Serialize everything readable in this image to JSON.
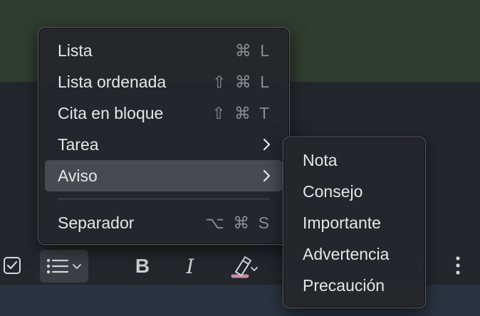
{
  "format_menu": {
    "items": [
      {
        "label": "Lista",
        "shortcut": "⌘ L"
      },
      {
        "label": "Lista ordenada",
        "shortcut": "⇧ ⌘ L"
      },
      {
        "label": "Cita en bloque",
        "shortcut": "⇧ ⌘ T"
      },
      {
        "label": "Tarea",
        "submenu_icon": "chevron-right-icon"
      },
      {
        "label": "Aviso",
        "submenu_icon": "chevron-right-icon",
        "highlighted": true
      },
      {
        "label": "Separador",
        "shortcut": "⌥ ⌘ S"
      }
    ]
  },
  "aviso_submenu": {
    "items": [
      "Nota",
      "Consejo",
      "Importante",
      "Advertencia",
      "Precaución"
    ]
  },
  "toolbar": {
    "bold_label": "B",
    "italic_label": "I",
    "icons": [
      "checkbox-icon",
      "bulleted-list-icon",
      "chevron-down-icon",
      "highlighter-icon",
      "more-vertical-icon"
    ]
  },
  "colors": {
    "menu_bg": "#26272b",
    "highlight": "#484a50",
    "text": "#e6e6e6",
    "shortcut_text": "#8a8c90"
  }
}
